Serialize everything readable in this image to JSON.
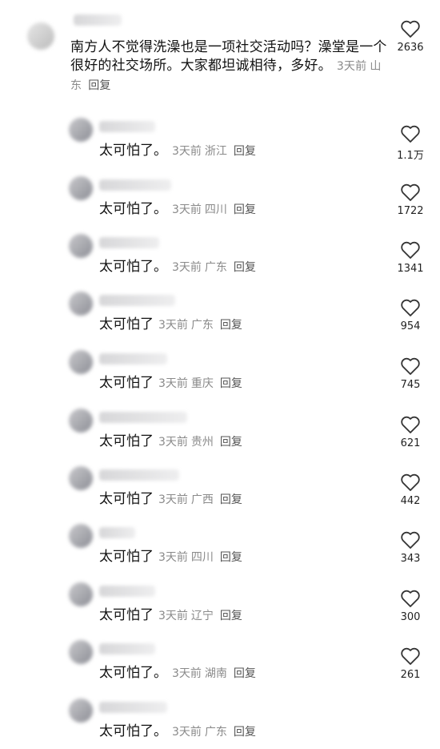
{
  "main_comment": {
    "text": "南方人不觉得洗澡也是一项社交活动吗？澡堂是一个很好的社交场所。大家都坦诚相待，多好。",
    "time": "3天前",
    "location": "山东",
    "reply": "回复",
    "likes": "2636"
  },
  "replies": [
    {
      "text": "太可怕了。",
      "time": "3天前",
      "location": "浙江",
      "reply": "回复",
      "likes": "1.1万"
    },
    {
      "text": "太可怕了。",
      "time": "3天前",
      "location": "四川",
      "reply": "回复",
      "likes": "1722"
    },
    {
      "text": "太可怕了。",
      "time": "3天前",
      "location": "广东",
      "reply": "回复",
      "likes": "1341"
    },
    {
      "text": "太可怕了",
      "time": "3天前",
      "location": "广东",
      "reply": "回复",
      "likes": "954"
    },
    {
      "text": "太可怕了",
      "time": "3天前",
      "location": "重庆",
      "reply": "回复",
      "likes": "745"
    },
    {
      "text": "太可怕了",
      "time": "3天前",
      "location": "贵州",
      "reply": "回复",
      "likes": "621"
    },
    {
      "text": "太可怕了",
      "time": "3天前",
      "location": "广西",
      "reply": "回复",
      "likes": "442"
    },
    {
      "text": "太可怕了",
      "time": "3天前",
      "location": "四川",
      "reply": "回复",
      "likes": "343"
    },
    {
      "text": "太可怕了",
      "time": "3天前",
      "location": "辽宁",
      "reply": "回复",
      "likes": "300"
    },
    {
      "text": "太可怕了。",
      "time": "3天前",
      "location": "湖南",
      "reply": "回复",
      "likes": "261"
    },
    {
      "text": "太可怕了。",
      "time": "3天前",
      "location": "广东",
      "reply": "回复"
    }
  ]
}
